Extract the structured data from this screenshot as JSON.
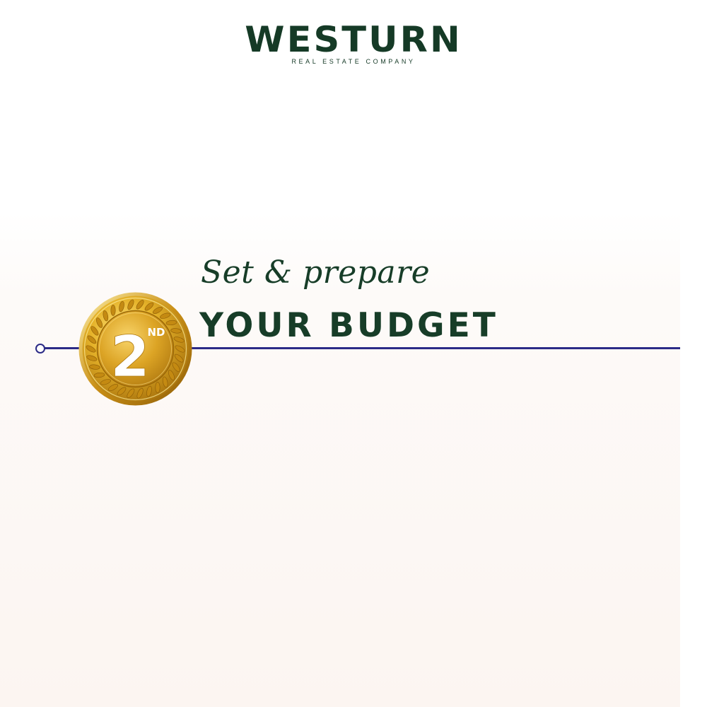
{
  "brand": {
    "name": "WESTURN",
    "tagline": "REAL ESTATE COMPANY",
    "color": "#153a26"
  },
  "step": {
    "number": "2",
    "suffix": "ND",
    "subtitle": "Set & prepare",
    "title": "YOUR BUDGET"
  },
  "colors": {
    "heading": "#173d28",
    "timeline": "#2b2a86",
    "medal_gold": "#d9a520",
    "medal_light": "#ffe27a",
    "medal_dark": "#a8720c",
    "background_tint": "#fcf5f1"
  },
  "icons": {
    "medal": "gold-laurel-medal-icon",
    "timeline_node": "circle-node-icon"
  }
}
